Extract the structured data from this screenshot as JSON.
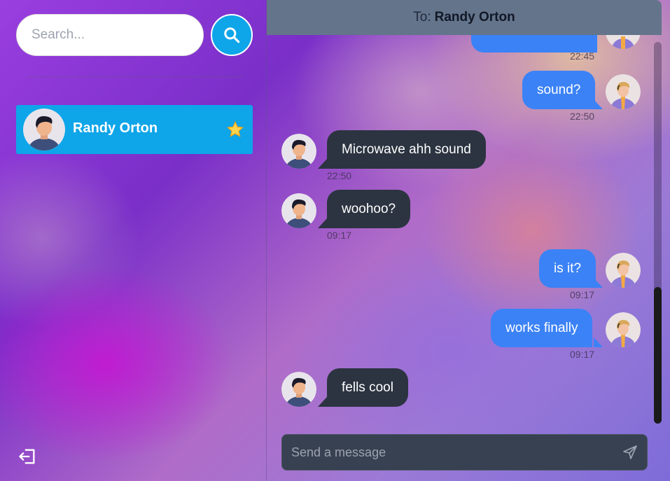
{
  "sidebar": {
    "search_placeholder": "Search...",
    "contacts": [
      {
        "name": "Randy Orton",
        "favorite": true
      }
    ]
  },
  "chat": {
    "to_label": "To:",
    "to_name": "Randy Orton",
    "input_placeholder": "Send a message",
    "messages": [
      {
        "direction": "out",
        "text": "",
        "time": "22:45"
      },
      {
        "direction": "out",
        "text": "sound?",
        "time": "22:50"
      },
      {
        "direction": "in",
        "text": "Microwave ahh sound",
        "time": "22:50"
      },
      {
        "direction": "in",
        "text": "woohoo?",
        "time": "09:17"
      },
      {
        "direction": "out",
        "text": "is it?",
        "time": "09:17"
      },
      {
        "direction": "out",
        "text": "works finally",
        "time": "09:17"
      },
      {
        "direction": "in",
        "text": "fells cool",
        "time": ""
      }
    ]
  },
  "colors": {
    "accent": "#0ea5e9",
    "outgoing_bubble": "#3b82f6",
    "incoming_bubble": "#2c3441",
    "header": "#64748b",
    "input_bar": "#374151"
  }
}
